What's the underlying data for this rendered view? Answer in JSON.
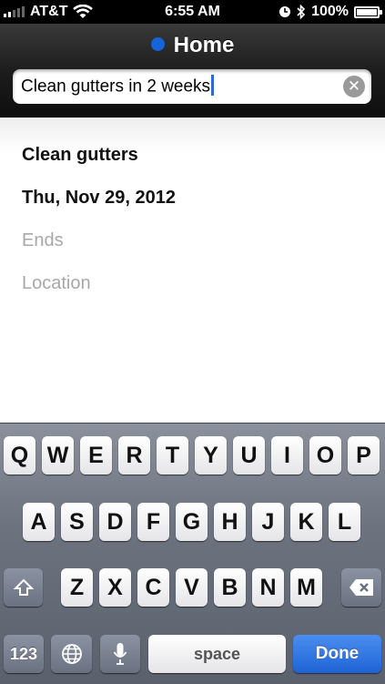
{
  "status_bar": {
    "carrier": "AT&T",
    "time": "6:55 AM",
    "battery_percent": "100%",
    "battery_level": 1.0
  },
  "header": {
    "title": "Home",
    "calendar_color": "#1565d8",
    "search_value": "Clean gutters in 2 weeks"
  },
  "event": {
    "title": "Clean gutters",
    "date": "Thu, Nov 29, 2012",
    "ends_placeholder": "Ends",
    "location_placeholder": "Location"
  },
  "keyboard": {
    "row1": [
      "Q",
      "W",
      "E",
      "R",
      "T",
      "Y",
      "U",
      "I",
      "O",
      "P"
    ],
    "row2": [
      "A",
      "S",
      "D",
      "F",
      "G",
      "H",
      "J",
      "K",
      "L"
    ],
    "row3": [
      "Z",
      "X",
      "C",
      "V",
      "B",
      "N",
      "M"
    ],
    "numbers_label": "123",
    "space_label": "space",
    "done_label": "Done",
    "accent_color": "#1e63d4"
  }
}
